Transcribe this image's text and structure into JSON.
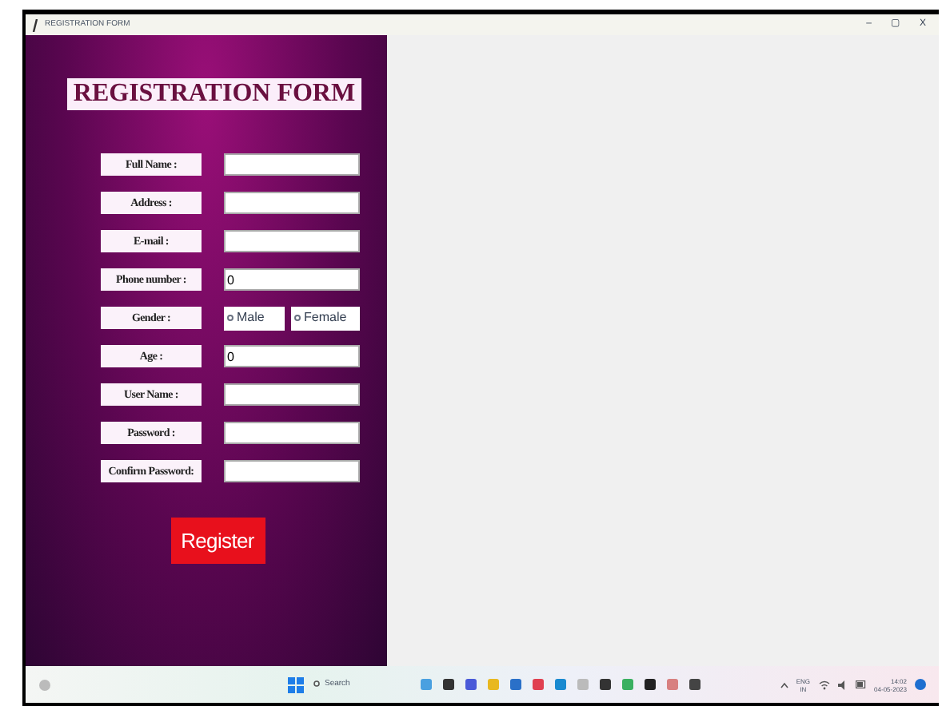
{
  "window": {
    "title": "REGISTRATION FORM",
    "controls": [
      "–",
      "▢",
      "X"
    ]
  },
  "form": {
    "heading": "REGISTRATION FORM",
    "fields": [
      {
        "kind": "text",
        "label": "Full Name :"
      },
      {
        "kind": "text",
        "label": "Address :"
      },
      {
        "kind": "text",
        "label": "E-mail :"
      },
      {
        "kind": "text",
        "label": "Phone number :",
        "value": "0"
      },
      {
        "kind": "radio",
        "label": "Gender :",
        "options": [
          {
            "label": "Male",
            "selected": false
          },
          {
            "label": "Female",
            "selected": false
          }
        ]
      },
      {
        "kind": "text",
        "label": "Age :",
        "value": "0"
      },
      {
        "kind": "text",
        "label": "User Name :"
      },
      {
        "kind": "text",
        "label": "Password :"
      },
      {
        "kind": "text",
        "label": "Confirm Password:"
      }
    ],
    "submit": "Register"
  },
  "taskbar": {
    "search": "Search",
    "language": [
      "ENG",
      "IN"
    ],
    "time": "14:02",
    "date": "04-05-2023"
  }
}
